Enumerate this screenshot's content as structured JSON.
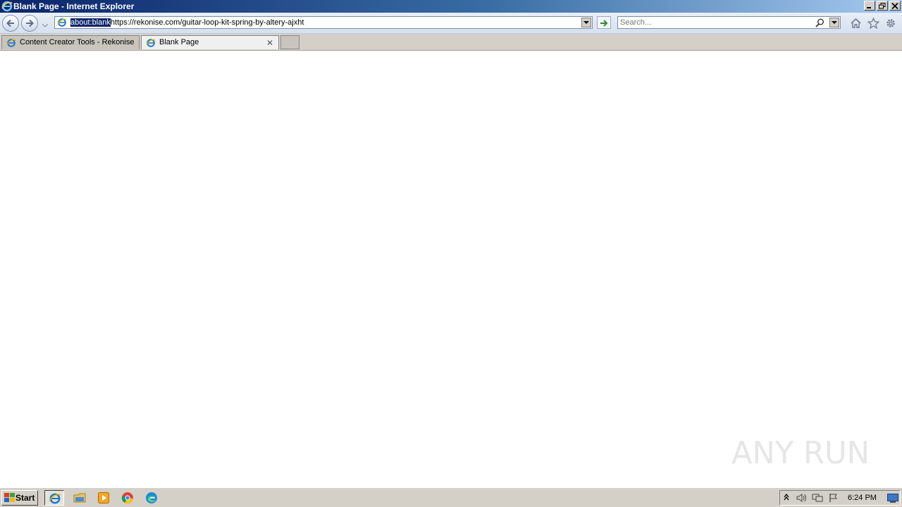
{
  "window": {
    "title": "Blank Page - Internet Explorer"
  },
  "address": {
    "url_selected": "about:blank",
    "url_rest": "https://rekonise.com/guitar-loop-kit-spring-by-altery-ajxht"
  },
  "search": {
    "placeholder": "Search..."
  },
  "tabs": [
    {
      "label": "Content Creator Tools - Rekonise",
      "active": false
    },
    {
      "label": "Blank Page",
      "active": true,
      "close": "✕"
    }
  ],
  "taskbar": {
    "start_label": "Start",
    "clock": "6:24 PM"
  },
  "watermark": {
    "text": "ANY RUN"
  },
  "colors": {
    "titlebar": "#0a246a",
    "selection": "#0a246a",
    "go_arrow": "#2e8b2e",
    "ie_blue": "#1e78c8"
  }
}
